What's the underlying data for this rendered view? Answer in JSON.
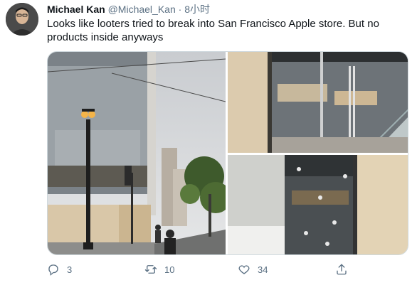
{
  "tweet": {
    "author_name": "Michael Kan",
    "author_handle": "@Michael_Kan",
    "separator": "·",
    "time": "8小时",
    "text": "Looks like looters tried to break into San Francisco Apple store. But no products inside anyways"
  },
  "actions": {
    "reply_icon": "reply-icon",
    "reply_count": "3",
    "retweet_icon": "retweet-icon",
    "retweet_count": "10",
    "like_icon": "heart-icon",
    "like_count": "34",
    "share_icon": "share-icon"
  },
  "colors": {
    "text": "#0f1419",
    "secondary": "#5b7083",
    "border": "#cfd9de"
  }
}
